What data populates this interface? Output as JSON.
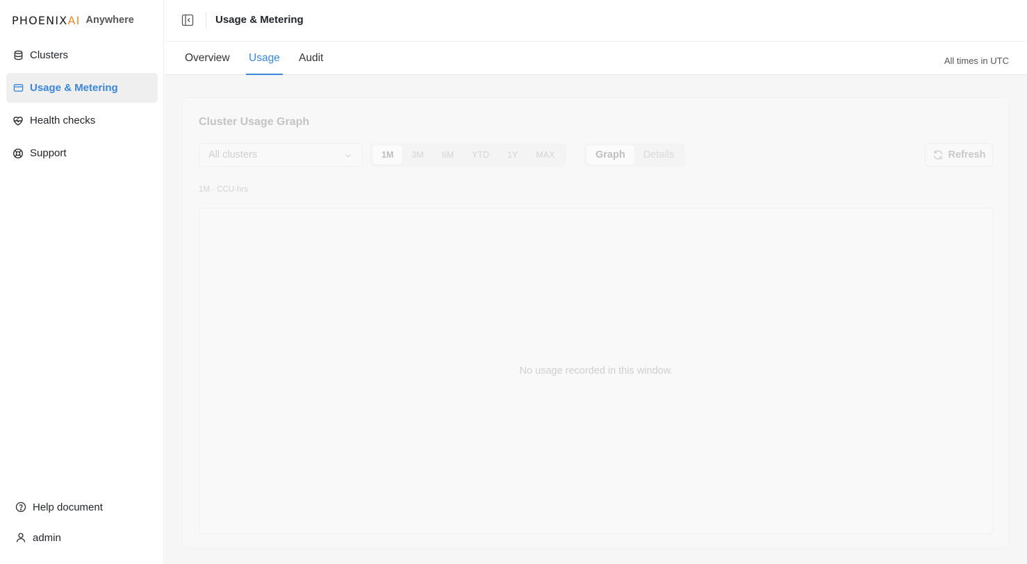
{
  "brand": {
    "logo_main": "PHOENIX",
    "logo_ai": "AI",
    "logo_sub": "Anywhere",
    "accent_color": "#e58a2e"
  },
  "sidebar": {
    "items": [
      {
        "label": "Clusters",
        "icon": "database-icon",
        "active": false
      },
      {
        "label": "Usage & Metering",
        "icon": "credit-card-icon",
        "active": true
      },
      {
        "label": "Health checks",
        "icon": "heart-pulse-icon",
        "active": false
      },
      {
        "label": "Support",
        "icon": "lifebuoy-icon",
        "active": false
      }
    ],
    "bottom": [
      {
        "label": "Help document",
        "icon": "help-circle-icon"
      },
      {
        "label": "admin",
        "icon": "user-icon"
      }
    ]
  },
  "header": {
    "title": "Usage & Metering",
    "collapse_icon": "sidebar-collapse-icon"
  },
  "tabs": {
    "items": [
      {
        "label": "Overview",
        "active": false
      },
      {
        "label": "Usage",
        "active": true
      },
      {
        "label": "Audit",
        "active": false
      }
    ],
    "timezone_note": "All times in UTC",
    "active_color": "#3a86d8"
  },
  "usage_card": {
    "title": "Cluster Usage Graph",
    "cluster_select": {
      "value": "All clusters"
    },
    "ranges": [
      {
        "label": "1M",
        "active": true
      },
      {
        "label": "3M",
        "active": false
      },
      {
        "label": "6M",
        "active": false
      },
      {
        "label": "YTD",
        "active": false
      },
      {
        "label": "1Y",
        "active": false
      },
      {
        "label": "MAX",
        "active": false
      }
    ],
    "views": [
      {
        "label": "Graph",
        "active": true
      },
      {
        "label": "Details",
        "active": false
      }
    ],
    "refresh_label": "Refresh",
    "meta": "1M · CCU-hrs",
    "empty_message": "No usage recorded in this window."
  }
}
